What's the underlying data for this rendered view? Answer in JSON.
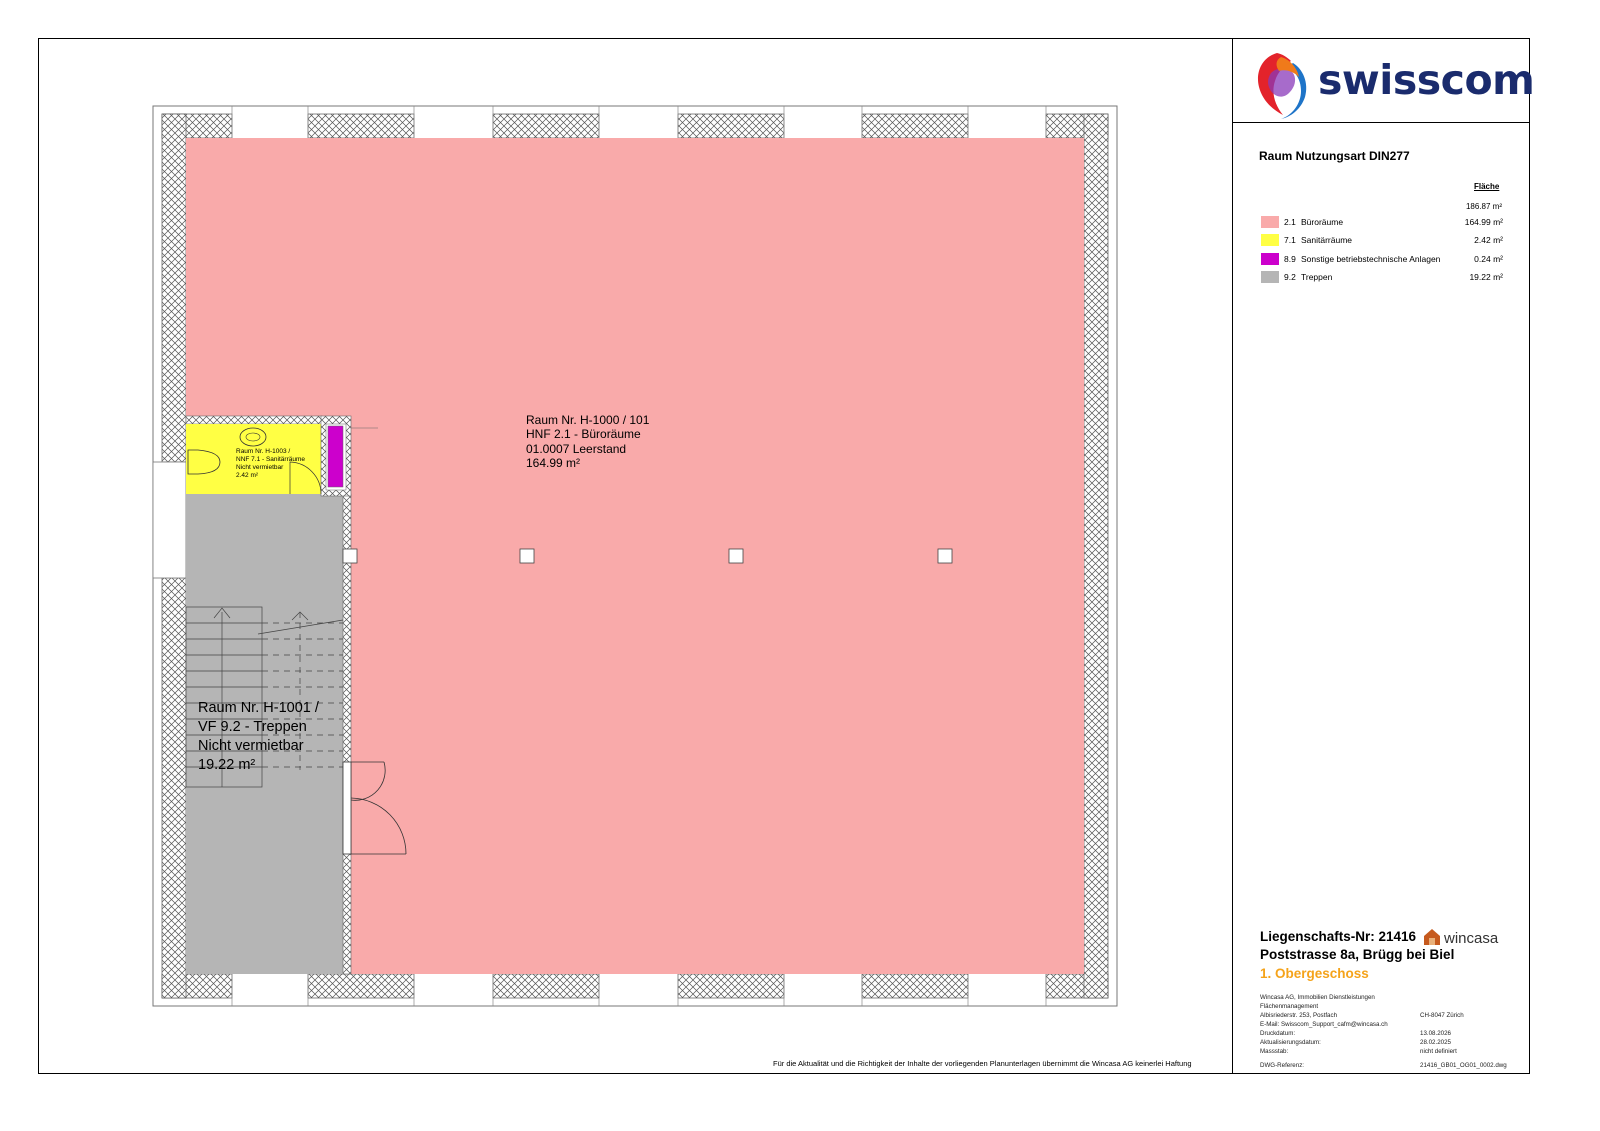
{
  "plan": {
    "main_room": {
      "line1": "Raum Nr. H-1000 / 101",
      "line2": "HNF 2.1 - Büroräume",
      "line3": "01.0007 Leerstand",
      "line4": "164.99 m²"
    },
    "stair_room": {
      "line1": "Raum Nr. H-1001 /",
      "line2": "VF 9.2 - Treppen",
      "line3": "Nicht vermietbar",
      "line4": "19.22 m²"
    },
    "wc_room": {
      "line1": "Raum Nr. H-1003 /",
      "line2": "NNF 7.1 - Sanitärräume",
      "line3": "Nicht vermietbar",
      "line4": "2.42 m²"
    },
    "disclaimer": "Für die Aktualität und die Richtigkeit der Inhalte der vorliegenden Planunterlagen übernimmt die Wincasa AG keinerlei Haftung"
  },
  "colors": {
    "office": "#f9aaaa",
    "sanitary": "#ffff44",
    "technical": "#cc00cc",
    "stairs": "#b5b5b5",
    "swisscom_blue": "#1a2b6d",
    "floor_label": "#f5a31a"
  },
  "title_block": {
    "logo_text": "swisscom",
    "legend_title": "Raum Nutzungsart DIN277",
    "legend_header": "Fläche",
    "legend_total": "186.87 m²",
    "legend": [
      {
        "code": "2.1",
        "name": "Büroräume",
        "area": "164.99 m²",
        "color": "#f9aaaa"
      },
      {
        "code": "7.1",
        "name": "Sanitärräume",
        "area": "2.42 m²",
        "color": "#ffff44"
      },
      {
        "code": "8.9",
        "name": "Sonstige betriebstechnische Anlagen",
        "area": "0.24 m²",
        "color": "#cc00cc"
      },
      {
        "code": "9.2",
        "name": "Treppen",
        "area": "19.22 m²",
        "color": "#b5b5b5"
      }
    ],
    "property_nr": "Liegenschafts-Nr: 21416",
    "wincasa_logo_text": "wincasa",
    "address": "Poststrasse 8a, Brügg bei Biel",
    "floor": "1. Obergeschoss",
    "company_line1": "Wincasa AG, Immobilien Dienstleistungen",
    "company_line2": "Flächenmanagement",
    "street": "Albisriederstr. 253, Postfach",
    "city": "CH-8047 Zürich",
    "email": "E-Mail: Swisscom_Support_cafm@wincasa.ch",
    "print_date_label": "Druckdatum:",
    "print_date": "13.08.2026",
    "update_date_label": "Aktualisierungsdatum:",
    "update_date": "28.02.2025",
    "scale_label": "Massstab:",
    "scale": "nicht definiert",
    "dwg_label": "DWG-Referenz:",
    "dwg": "21416_GB01_OG01_0002.dwg"
  }
}
